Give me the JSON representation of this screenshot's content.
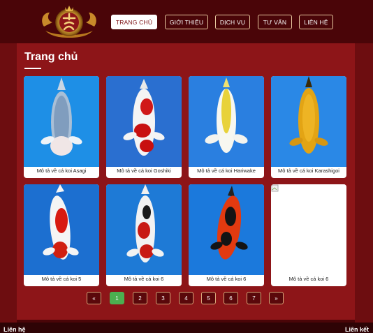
{
  "nav": {
    "items": [
      "TRANG CHỦ",
      "GIỚI THIỆU",
      "DỊCH VỤ",
      "TƯ VẤN",
      "LIÊN HỆ"
    ]
  },
  "page": {
    "title": "Trang chủ"
  },
  "gallery": [
    {
      "caption": "Mô tả về cá koi Asagi",
      "image": "koi-asagi"
    },
    {
      "caption": "Mô tả về cá koi Goshiki",
      "image": "koi-goshiki"
    },
    {
      "caption": "Mô tả về cá koi Hariwake",
      "image": "koi-hariwake"
    },
    {
      "caption": "Mô tả về cá koi Karashigoi",
      "image": "koi-karashigoi"
    },
    {
      "caption": "Mô tả về cá koi 5",
      "image": "koi-kohaku"
    },
    {
      "caption": "Mô tả về cá koi 6",
      "image": "koi-showa-white"
    },
    {
      "caption": "Mô tả về cá koi 6",
      "image": "koi-showa-dark"
    },
    {
      "caption": "Mô tả về cá koi 6",
      "image": "broken-image"
    }
  ],
  "pagination": {
    "prev": "«",
    "pages": [
      "1",
      "2",
      "3",
      "4",
      "5",
      "6",
      "7"
    ],
    "next": "»",
    "current": "1"
  },
  "footer": {
    "left": "Liên hệ",
    "right": "Liên kết"
  },
  "colors": {
    "header_bg": "#4a0508",
    "content_bg": "#8d1518",
    "active_page": "#4caf50",
    "water": "#1e8fe6"
  }
}
